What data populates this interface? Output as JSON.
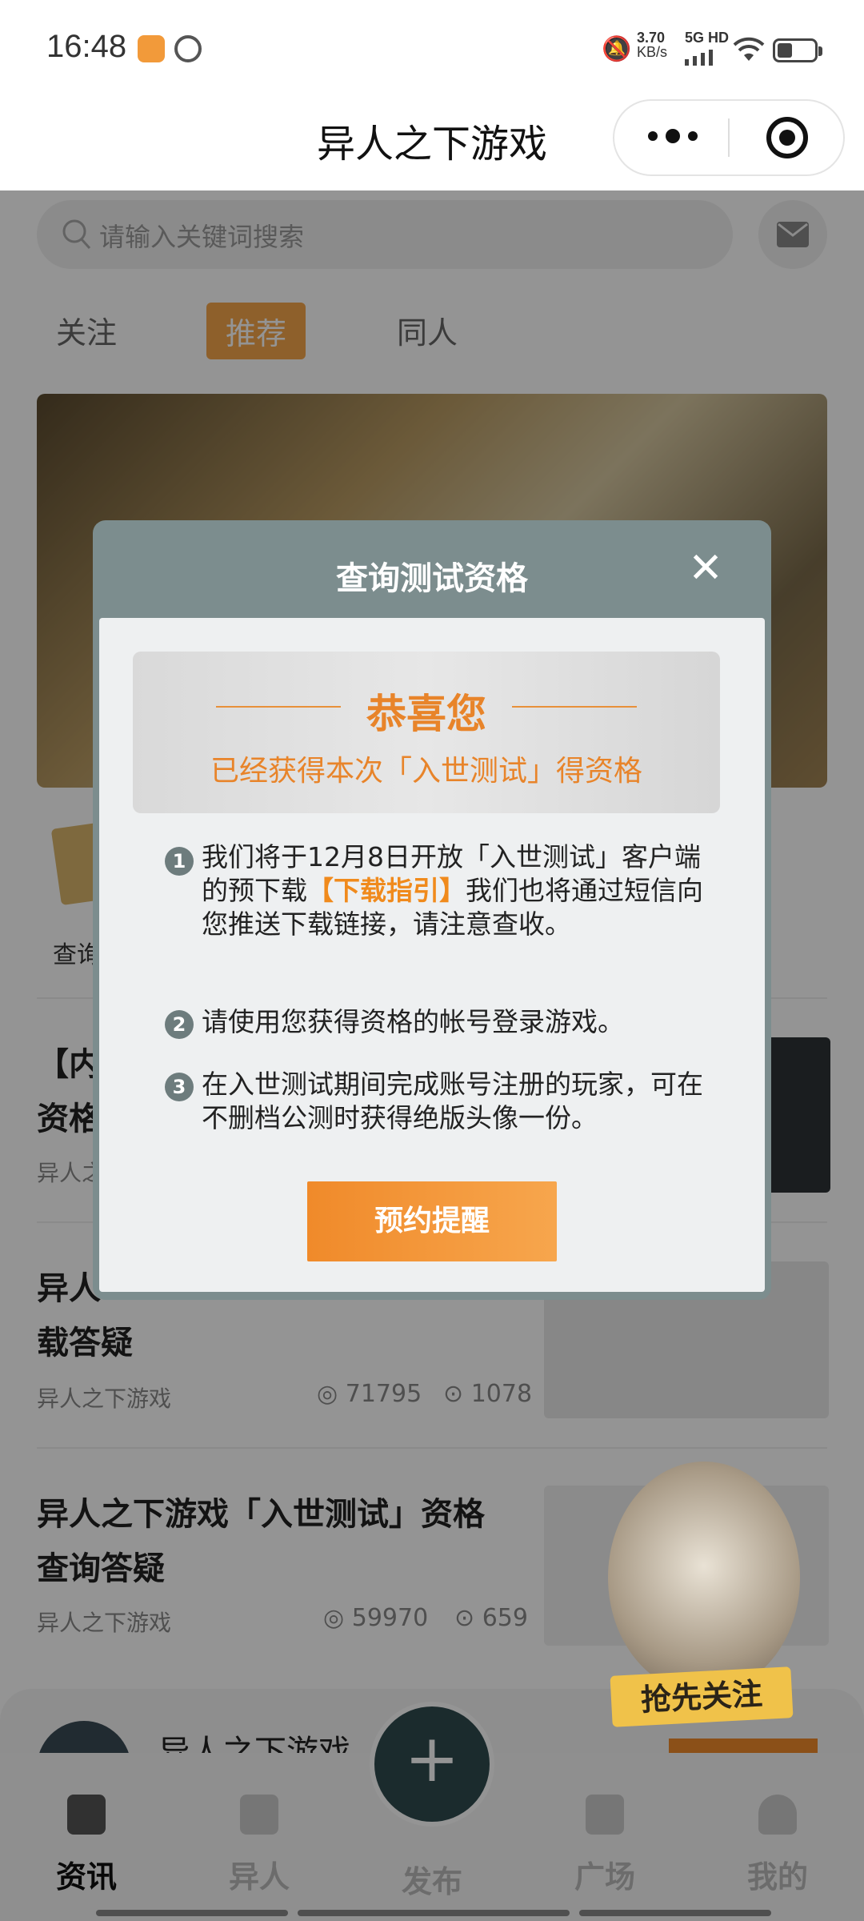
{
  "status_bar": {
    "time": "16:48",
    "net_speed_top": "3.70",
    "net_speed_bottom": "KB/s",
    "signal_label": "5G HD"
  },
  "header": {
    "title": "异人之下游戏"
  },
  "search": {
    "placeholder": "请输入关键词搜索"
  },
  "tabs": [
    "关注",
    "推荐",
    "同人"
  ],
  "shortcut": {
    "label": "查询"
  },
  "articles": [
    {
      "title_line1": "【内",
      "title_line2": "资格",
      "source": "异人之"
    },
    {
      "title_line1": "异人",
      "title_line2": "载答疑",
      "source": "异人之下游戏",
      "views": "71795",
      "comments": "1078"
    },
    {
      "title_line1": "异人之下游戏「入世测试」资格",
      "title_line2": "查询答疑",
      "source": "异人之下游戏",
      "views": "59970",
      "comments": "659"
    }
  ],
  "bottom_card": {
    "name": "异人之下游戏"
  },
  "nav": {
    "items": [
      "资讯",
      "异人",
      "发布",
      "广场",
      "我的"
    ],
    "fab_symbol": "+"
  },
  "modal": {
    "title": "查询测试资格",
    "close_symbol": "✕",
    "congrats_title": "恭喜您",
    "congrats_sub": "已经获得本次「入世测试」得资格",
    "items": [
      {
        "num": "1",
        "text_a": "我们将于12月8日开放「入世测试」客户端的预下载",
        "highlight": "【下载指引】",
        "text_b": "我们也将通过短信向您推送下载链接，请注意查收。"
      },
      {
        "num": "2",
        "text_a": "请使用您获得资格的帐号登录游戏。"
      },
      {
        "num": "3",
        "text_a": "在入世测试期间完成账号注册的玩家，可在不删档公测时获得绝版头像一份。"
      }
    ],
    "button": "预约提醒"
  },
  "promo": {
    "label": "抢先关注"
  },
  "colors": {
    "accent_orange": "#f08a2a",
    "modal_header": "#7c8d8e"
  }
}
